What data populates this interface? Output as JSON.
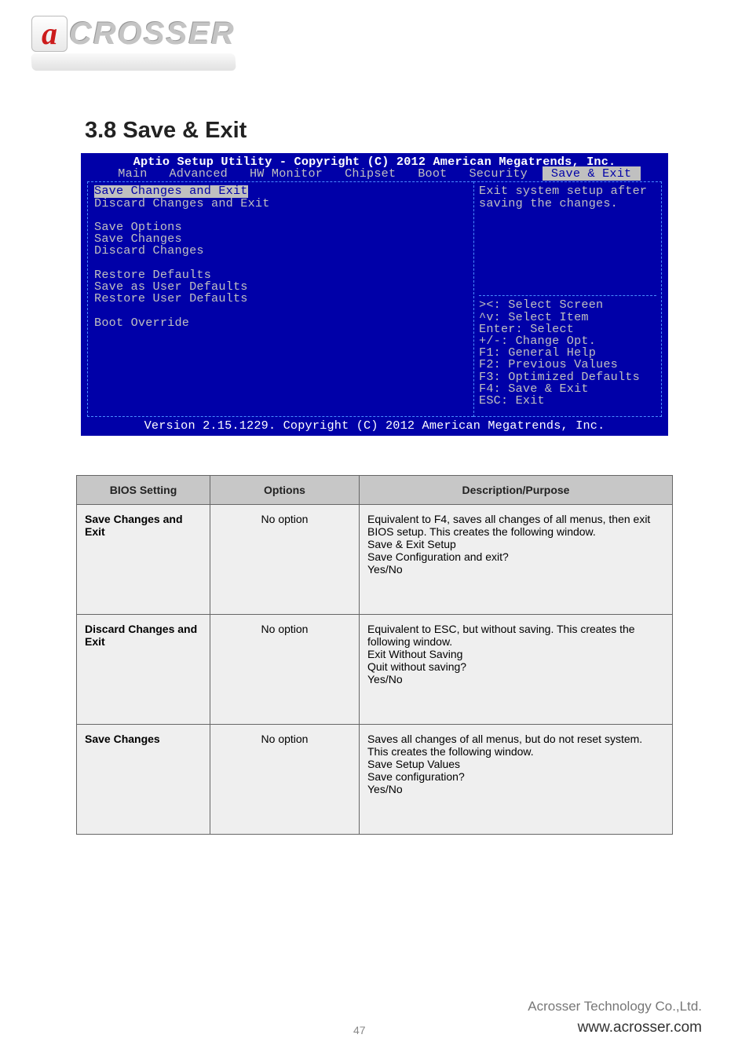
{
  "brand": {
    "mark": "a",
    "word": "CROSSER"
  },
  "section_title": "3.8 Save & Exit",
  "bios": {
    "title": "Aptio Setup Utility - Copyright (C) 2012 American Megatrends, Inc.",
    "tabs": [
      "Main",
      "Advanced",
      "HW Monitor",
      "Chipset",
      "Boot",
      "Security",
      "Save & Exit"
    ],
    "active_tab_index": 6,
    "left_items": [
      {
        "text": "Save Changes and Exit",
        "selected": true
      },
      {
        "text": "Discard Changes and Exit"
      },
      {
        "text": ""
      },
      {
        "text": "Save Options",
        "header": true
      },
      {
        "text": "Save Changes"
      },
      {
        "text": "Discard Changes"
      },
      {
        "text": ""
      },
      {
        "text": "Restore Defaults"
      },
      {
        "text": "Save as User Defaults"
      },
      {
        "text": "Restore User Defaults"
      },
      {
        "text": ""
      },
      {
        "text": "Boot Override",
        "header": true
      }
    ],
    "help_text": "Exit system setup after saving the changes.",
    "key_help": "><: Select Screen\n^v: Select Item\nEnter: Select\n+/-: Change Opt.\nF1: General Help\nF2: Previous Values\nF3: Optimized Defaults\nF4: Save & Exit\nESC: Exit",
    "footer": "Version 2.15.1229. Copyright (C) 2012 American Megatrends, Inc."
  },
  "table": {
    "headers": [
      "BIOS Setting",
      "Options",
      "Description/Purpose"
    ],
    "rows": [
      {
        "setting": "Save Changes and Exit",
        "options": "No option",
        "desc": "Equivalent to F4, saves all changes of all menus, then exit BIOS setup. This creates the following window.\nSave & Exit Setup\nSave Configuration and exit?\nYes/No"
      },
      {
        "setting": "Discard Changes and Exit",
        "options": "No option",
        "desc": "Equivalent to ESC, but without saving. This creates the following window.\nExit Without Saving\nQuit without saving?\nYes/No"
      },
      {
        "setting": "Save Changes",
        "options": "No option",
        "desc": "Saves all changes of all menus, but do not reset system. This creates the following window.\nSave Setup Values\nSave configuration?\nYes/No"
      }
    ]
  },
  "footer": {
    "company": "Acrosser Technology Co.,Ltd.",
    "url": "www.acrosser.com",
    "page": "47"
  }
}
